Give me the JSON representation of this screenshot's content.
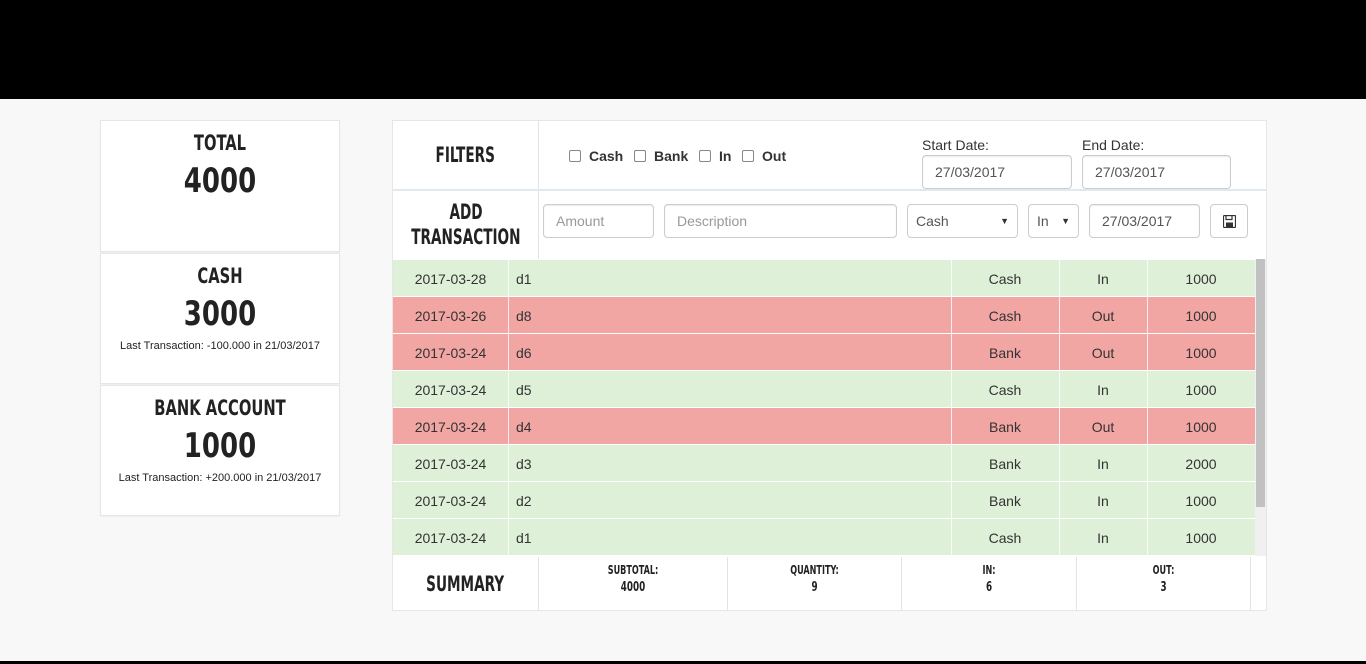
{
  "cards": {
    "total": {
      "title": "Total",
      "value": "4000"
    },
    "cash": {
      "title": "Cash",
      "value": "3000",
      "note": "Last Transaction: -100.000 in 21/03/2017"
    },
    "bank": {
      "title": "Bank Account",
      "value": "1000",
      "note": "Last Transaction: +200.000 in 21/03/2017"
    }
  },
  "filters": {
    "label": "Filters",
    "options": [
      "Cash",
      "Bank",
      "In",
      "Out"
    ],
    "start_label": "Start Date:",
    "start_value": "27/03/2017",
    "end_label": "End Date:",
    "end_value": "27/03/2017"
  },
  "add": {
    "label_line1": "Add",
    "label_line2": "Transaction",
    "amount_placeholder": "Amount",
    "description_placeholder": "Description",
    "account_value": "Cash",
    "direction_value": "In",
    "date_value": "27/03/2017",
    "save_icon": "floppy-disk-icon"
  },
  "transactions": [
    {
      "date": "2017-03-28",
      "desc": "d1",
      "account": "Cash",
      "dir": "In",
      "amount": "1000"
    },
    {
      "date": "2017-03-26",
      "desc": "d8",
      "account": "Cash",
      "dir": "Out",
      "amount": "1000"
    },
    {
      "date": "2017-03-24",
      "desc": "d6",
      "account": "Bank",
      "dir": "Out",
      "amount": "1000"
    },
    {
      "date": "2017-03-24",
      "desc": "d5",
      "account": "Cash",
      "dir": "In",
      "amount": "1000"
    },
    {
      "date": "2017-03-24",
      "desc": "d4",
      "account": "Bank",
      "dir": "Out",
      "amount": "1000"
    },
    {
      "date": "2017-03-24",
      "desc": "d3",
      "account": "Bank",
      "dir": "In",
      "amount": "2000"
    },
    {
      "date": "2017-03-24",
      "desc": "d2",
      "account": "Bank",
      "dir": "In",
      "amount": "1000"
    },
    {
      "date": "2017-03-24",
      "desc": "d1",
      "account": "Cash",
      "dir": "In",
      "amount": "1000"
    }
  ],
  "summary": {
    "label": "Summary",
    "subtotal_label": "Subtotal:",
    "subtotal": "4000",
    "quantity_label": "Quantity:",
    "quantity": "9",
    "in_label": "In:",
    "in": "6",
    "out_label": "Out:",
    "out": "3"
  },
  "colors": {
    "in_row": "#dff0d8",
    "out_row": "#f2a6a4",
    "top_bar": "#000000"
  }
}
